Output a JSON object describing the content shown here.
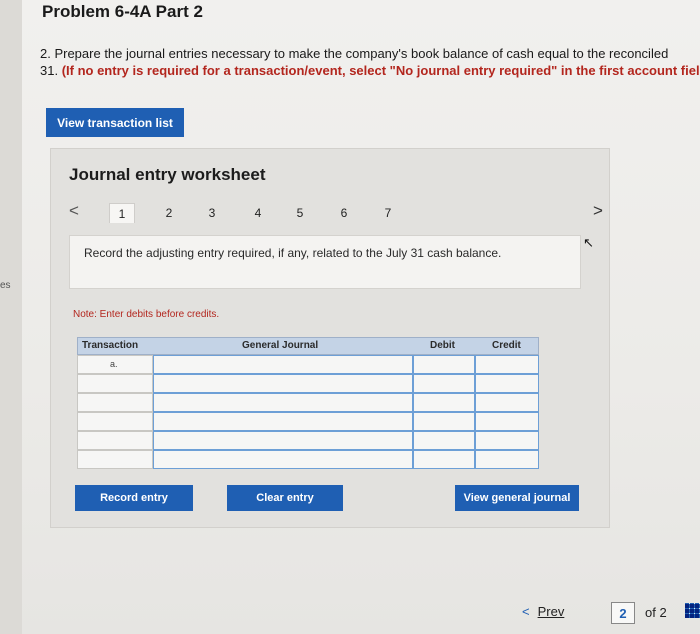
{
  "gutter": {
    "text": "es"
  },
  "header": {
    "title": "Problem 6-4A Part 2"
  },
  "instructions": {
    "line1": "2. Prepare the journal entries necessary to make the company's book balance of cash equal to the reconciled",
    "line2_prefix": "31. ",
    "line2_red": "(If no entry is required for a transaction/event, select \"No journal entry required\" in the first account fiel"
  },
  "buttons": {
    "view_transactions": "View transaction list",
    "record_entry": "Record entry",
    "clear_entry": "Clear entry",
    "view_general_journal": "View general journal"
  },
  "worksheet": {
    "title": "Journal entry worksheet",
    "steps": [
      "1",
      "2",
      "3",
      "4",
      "5",
      "6",
      "7"
    ],
    "active_step": "1",
    "prompt": "Record the adjusting entry required, if any, related to the July 31 cash balance.",
    "note": "Note: Enter debits before credits.",
    "table": {
      "headers": [
        "Transaction",
        "General Journal",
        "Debit",
        "Credit"
      ],
      "rows": [
        {
          "transaction": "a.",
          "general_journal": "",
          "debit": "",
          "credit": ""
        },
        {
          "transaction": "",
          "general_journal": "",
          "debit": "",
          "credit": ""
        },
        {
          "transaction": "",
          "general_journal": "",
          "debit": "",
          "credit": ""
        },
        {
          "transaction": "",
          "general_journal": "",
          "debit": "",
          "credit": ""
        },
        {
          "transaction": "",
          "general_journal": "",
          "debit": "",
          "credit": ""
        },
        {
          "transaction": "",
          "general_journal": "",
          "debit": "",
          "credit": ""
        }
      ]
    }
  },
  "footer": {
    "prev_label": "Prev",
    "current_page": "2",
    "page_total": "of 2"
  },
  "icons": {
    "prev_chevron": "chevron-left-icon",
    "next_chevron": "chevron-right-icon",
    "grid": "grid-icon"
  },
  "colors": {
    "accent_blue": "#1f5fb3",
    "instruction_red": "#b3261e",
    "table_header": "#c4d3e6"
  }
}
